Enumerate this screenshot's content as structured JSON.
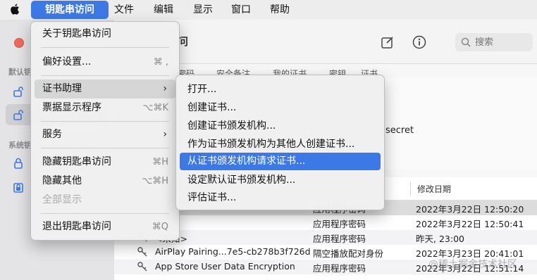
{
  "menubar": {
    "items": [
      {
        "label": "钥匙串访问"
      },
      {
        "label": "文件"
      },
      {
        "label": "编辑"
      },
      {
        "label": "显示"
      },
      {
        "label": "窗口"
      },
      {
        "label": "帮助"
      }
    ]
  },
  "app_menu": {
    "about": "关于钥匙串访问",
    "preferences": "偏好设置...",
    "preferences_shortcut": "⌘ ,",
    "cert_assistant": "证书助理",
    "ticket_viewer": "票据显示程序",
    "ticket_viewer_shortcut": "⌥⌘K",
    "services": "服务",
    "hide": "隐藏钥匙串访问",
    "hide_shortcut": "⌘H",
    "hide_others": "隐藏其他",
    "hide_others_shortcut": "⌥⌘H",
    "show_all": "全部显示",
    "quit": "退出钥匙串访问",
    "quit_shortcut": "⌘Q"
  },
  "cert_submenu": {
    "items": [
      "打开...",
      "创建证书...",
      "创建证书颁发机构...",
      "作为证书颁发机构为其他人创建证书...",
      "从证书颁发机构请求证书...",
      "设定默认证书颁发机构...",
      "评估证书..."
    ]
  },
  "window": {
    "title": "问",
    "search_placeholder": "搜索",
    "sidebar_heading_1": "默认钥",
    "sidebar_heading_2": "系统钥",
    "tabs": [
      "密码",
      "安全备注",
      "我的证书",
      "密钥",
      "证书"
    ],
    "detail_secret": "secret"
  },
  "table": {
    "date_header": "修改日期",
    "rows": [
      {
        "name": "",
        "kind": "应用程序密码",
        "date": "2022年3月22日 12:50:20"
      },
      {
        "name": ">",
        "kind": "应用程序密码",
        "date": "2022年3月22日 12:50:41"
      },
      {
        "name": "<未知>",
        "kind": "应用程序密码",
        "date": "昨天, 23:00"
      },
      {
        "name": "AirPlay Pairing...7e5-cb278b3f726d",
        "kind": "隔空播放配对身份",
        "date": "2022年3月23日 20:41:01"
      },
      {
        "name": "App Store User Data Encryption",
        "kind": "应用程序密码",
        "date": "2022年3月22日 12:51:14"
      }
    ]
  },
  "watermark": "@稀土掘金技术社区",
  "colors": {
    "accent": "#3d79e6",
    "close": "#ed6a5e"
  }
}
